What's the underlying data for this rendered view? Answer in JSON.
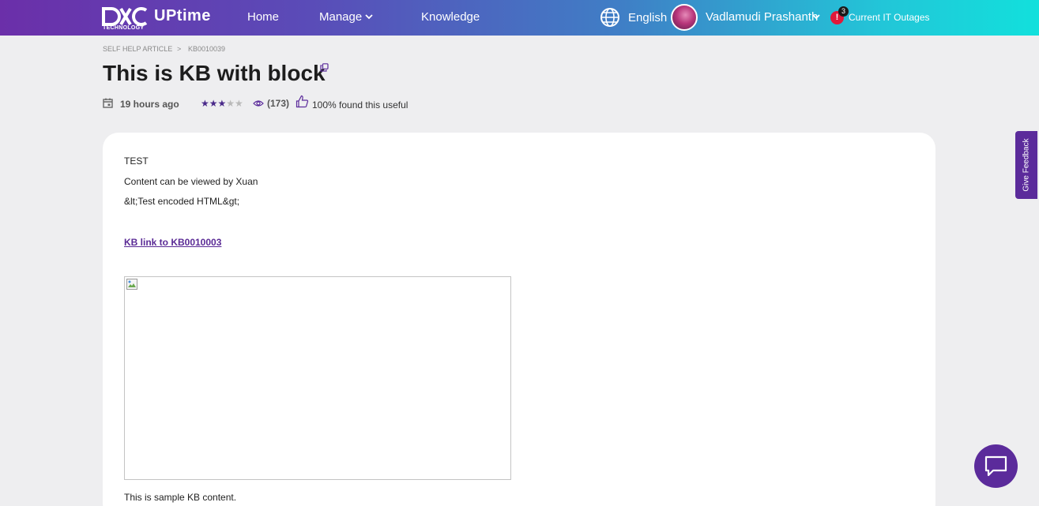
{
  "header": {
    "logo_sub": "TECHNOLOGY",
    "brand": "UPtime",
    "nav": {
      "home": "Home",
      "manage": "Manage",
      "knowledge": "Knowledge"
    },
    "language": "English",
    "user_name": "Vadlamudi Prashanth",
    "alert_symbol": "!",
    "outage_count": "3",
    "outages_label": "Current IT Outages"
  },
  "breadcrumb": {
    "section": "SELF HELP ARTICLE",
    "separator": ">",
    "article_id": "KB0010039"
  },
  "article": {
    "title": "This is KB with block",
    "time": "19 hours ago",
    "rating": {
      "stars_on": "★★★",
      "stars_off": "★★"
    },
    "views": "(173)",
    "useful": "100% found this useful"
  },
  "content": {
    "line1": "TEST",
    "line2": "Content can be viewed by Xuan",
    "line3": "&lt;Test encoded HTML&gt;",
    "kb_link": "KB link to KB0010003",
    "line4": "This is sample KB content."
  },
  "feedback_tab": "Give Feedback",
  "colors": {
    "accent": "#5b2b9b",
    "alert": "#e0193a"
  }
}
